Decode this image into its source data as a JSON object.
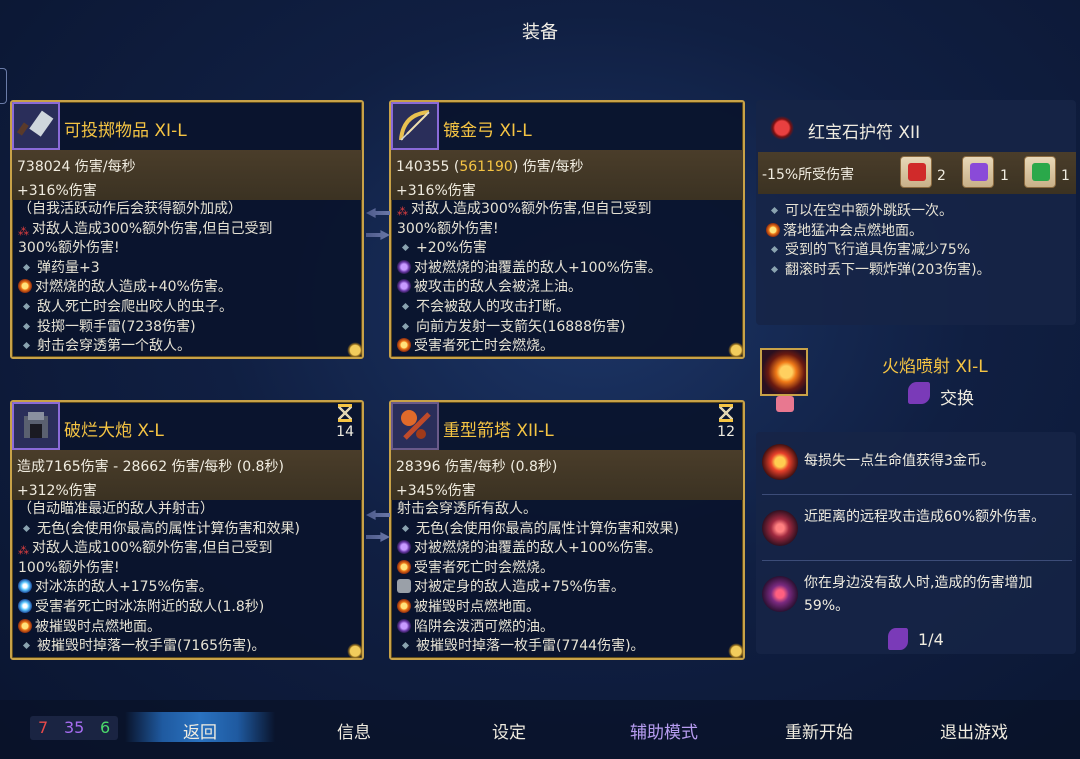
{
  "title": "装备",
  "cards": [
    {
      "name": "可投掷物品 XI-L",
      "stat1": "738024 伤害/每秒",
      "stat2": "+316%伤害",
      "effects": [
        {
          "icon": "none",
          "t": "（自我活跃动作后会获得额外加成）"
        },
        {
          "icon": "red",
          "t": "对敌人造成300%额外伤害,但自己受到"
        },
        {
          "icon": "none",
          "t": "300%额外伤害!"
        },
        {
          "icon": "bullet",
          "t": "弹药量+3"
        },
        {
          "icon": "fire",
          "t": "对燃烧的敌人造成+40%伤害。"
        },
        {
          "icon": "bullet",
          "t": "敌人死亡时会爬出咬人的虫子。"
        },
        {
          "icon": "bullet",
          "t": "投掷一颗手雷(7238伤害)"
        },
        {
          "icon": "bullet",
          "t": "射击会穿透第一个敌人。"
        }
      ]
    },
    {
      "name": "镀金弓 XI-L",
      "stat1a": "140355 (",
      "stat1b": "561190",
      "stat1c": ") 伤害/每秒",
      "stat2": "+316%伤害",
      "effects": [
        {
          "icon": "red",
          "t": "对敌人造成300%额外伤害,但自己受到"
        },
        {
          "icon": "none",
          "t": "300%额外伤害!"
        },
        {
          "icon": "bullet",
          "t": "+20%伤害"
        },
        {
          "icon": "oil",
          "t": "对被燃烧的油覆盖的敌人+100%伤害。"
        },
        {
          "icon": "oil",
          "t": "被攻击的敌人会被浇上油。"
        },
        {
          "icon": "bullet",
          "t": "不会被敌人的攻击打断。"
        },
        {
          "icon": "bullet",
          "t": "向前方发射一支箭矢(16888伤害)"
        },
        {
          "icon": "fire",
          "t": "受害者死亡时会燃烧。"
        }
      ]
    },
    {
      "name": "破烂大炮 X-L",
      "timer": "14",
      "stat1": "造成7165伤害 - 28662 伤害/每秒 (0.8秒)",
      "stat2": "+312%伤害",
      "effects": [
        {
          "icon": "none",
          "t": "（自动瞄准最近的敌人并射击）"
        },
        {
          "icon": "bullet",
          "t": "无色(会使用你最高的属性计算伤害和效果)"
        },
        {
          "icon": "red",
          "t": "对敌人造成100%额外伤害,但自己受到"
        },
        {
          "icon": "none",
          "t": "100%额外伤害!"
        },
        {
          "icon": "ice",
          "t": "对冰冻的敌人+175%伤害。"
        },
        {
          "icon": "ice",
          "t": "受害者死亡时冰冻附近的敌人(1.8秒)"
        },
        {
          "icon": "fire",
          "t": "被摧毁时点燃地面。"
        },
        {
          "icon": "bullet",
          "t": "被摧毁时掉落一枚手雷(7165伤害)。"
        }
      ]
    },
    {
      "name": "重型箭塔 XII-L",
      "timer": "12",
      "stat1": "28396 伤害/每秒 (0.8秒)",
      "stat2": "+345%伤害",
      "effects": [
        {
          "icon": "none",
          "t": "射击会穿透所有敌人。"
        },
        {
          "icon": "bullet",
          "t": "无色(会使用你最高的属性计算伤害和效果)"
        },
        {
          "icon": "oil",
          "t": "对被燃烧的油覆盖的敌人+100%伤害。"
        },
        {
          "icon": "fire",
          "t": "受害者死亡时会燃烧。"
        },
        {
          "icon": "lock",
          "t": "对被定身的敌人造成+75%伤害。"
        },
        {
          "icon": "fire",
          "t": "被摧毁时点燃地面。"
        },
        {
          "icon": "oil",
          "t": "陷阱会泼洒可燃的油。"
        },
        {
          "icon": "bullet",
          "t": "被摧毁时掉落一枚手雷(7744伤害)。"
        }
      ]
    }
  ],
  "amulet": {
    "name": "红宝石护符 XII",
    "stat": "-15%所受伤害",
    "scrolls": [
      {
        "icon": "red-fist-scroll-icon",
        "count": "2",
        "color": "#d02a2a"
      },
      {
        "icon": "purple-bolt-scroll-icon",
        "count": "1",
        "color": "#8a4ad8"
      },
      {
        "icon": "green-cross-scroll-icon",
        "count": "1",
        "color": "#2aa84a"
      }
    ],
    "effects": [
      "可以在空中额外跳跃一次。",
      "落地猛冲会点燃地面。",
      "受到的飞行道具伤害减少75%",
      "翻滚时丢下一颗炸弹(203伤害)。"
    ]
  },
  "skill": {
    "name": "火焰喷射 XI-L",
    "swap": "交换"
  },
  "mutations": [
    {
      "icon": "gold-blood-icon",
      "text": "每损失一点生命值获得3金币。",
      "color": "#e8402a"
    },
    {
      "icon": "close-range-icon",
      "text": "近距离的远程攻击造成60%额外伤害。",
      "color": "#a02a40"
    },
    {
      "icon": "solitude-icon",
      "text": "你在身边没有敌人时,造成的伤害增加59%。",
      "color": "#7a2a80"
    }
  ],
  "mutation_count": "1/4",
  "stats_counts": {
    "brutality": "7",
    "tactics": "35",
    "survival": "6"
  },
  "menu": [
    "返回",
    "信息",
    "设定",
    "辅助模式",
    "重新开始",
    "退出游戏"
  ],
  "colors": {
    "gold": "#c8a248",
    "brutality": "#e84a4a",
    "tactics": "#a66cf0",
    "survival": "#4ad86a",
    "assist": "#b79cf0"
  }
}
